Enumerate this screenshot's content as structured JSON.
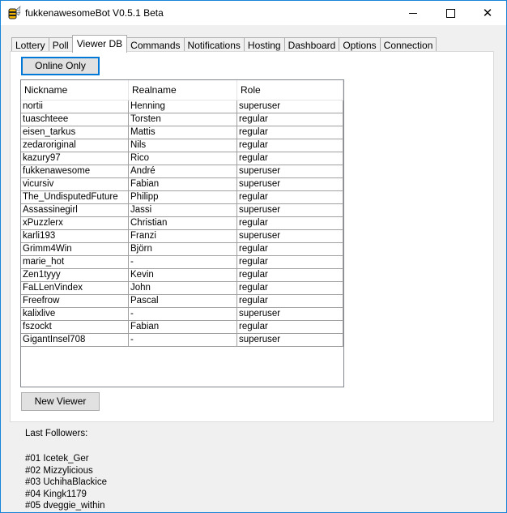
{
  "window": {
    "title": "fukkenawesomeBot V0.5.1 Beta"
  },
  "tabs": [
    {
      "label": "Lottery",
      "active": false
    },
    {
      "label": "Poll",
      "active": false
    },
    {
      "label": "Viewer DB",
      "active": true
    },
    {
      "label": "Commands",
      "active": false
    },
    {
      "label": "Notifications",
      "active": false
    },
    {
      "label": "Hosting",
      "active": false
    },
    {
      "label": "Dashboard",
      "active": false
    },
    {
      "label": "Options",
      "active": false
    },
    {
      "label": "Connection",
      "active": false
    }
  ],
  "viewer_db": {
    "online_only_label": "Online Only",
    "new_viewer_label": "New Viewer",
    "columns": [
      "Nickname",
      "Realname",
      "Role"
    ],
    "rows": [
      [
        "nortii",
        "Henning",
        "superuser"
      ],
      [
        "tuaschteee",
        "Torsten",
        "regular"
      ],
      [
        "eisen_tarkus",
        "Mattis",
        "regular"
      ],
      [
        "zedaroriginal",
        "Nils",
        "regular"
      ],
      [
        "kazury97",
        "Rico",
        "regular"
      ],
      [
        "fukkenawesome",
        "André",
        "superuser"
      ],
      [
        "vicursiv",
        "Fabian",
        "superuser"
      ],
      [
        "The_UndisputedFuture",
        "Philipp",
        "regular"
      ],
      [
        "Assassinegirl",
        "Jassi",
        "superuser"
      ],
      [
        "xPuzzlerx",
        "Christian",
        "regular"
      ],
      [
        "karli193",
        "Franzi",
        "superuser"
      ],
      [
        "Grimm4Win",
        "Björn",
        "regular"
      ],
      [
        "marie_hot",
        "-",
        "regular"
      ],
      [
        "Zen1tyyy",
        "Kevin",
        "regular"
      ],
      [
        "FaLLenVindex",
        "John",
        "regular"
      ],
      [
        "Freefrow",
        "Pascal",
        "regular"
      ],
      [
        "kalixlive",
        "-",
        "superuser"
      ],
      [
        "fszockt",
        "Fabian",
        "regular"
      ],
      [
        "GigantInsel708",
        "-",
        "superuser"
      ]
    ]
  },
  "followers": {
    "title": "Last Followers:",
    "items": [
      "#01 Icetek_Ger",
      "#02 Mizzylicious",
      "#03 UchihaBlackice",
      "#04 Kingk1179",
      "#05 dveggie_within"
    ]
  },
  "icons": {
    "app": "bee-icon",
    "minimize": "minimize-icon",
    "maximize": "maximize-icon",
    "close": "close-icon"
  }
}
